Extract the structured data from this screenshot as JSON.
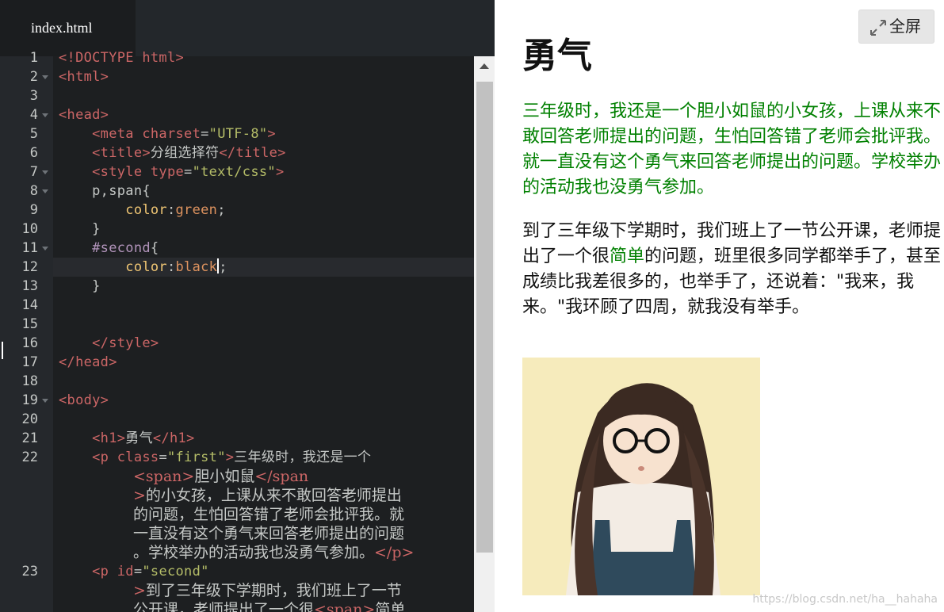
{
  "editor": {
    "tab_label": "index.html",
    "lines": [
      {
        "n": "1",
        "fold": false,
        "tokens": [
          [
            "tag",
            "<!DOCTYPE html>"
          ]
        ]
      },
      {
        "n": "2",
        "fold": true,
        "tokens": [
          [
            "tag",
            "<html>"
          ]
        ]
      },
      {
        "n": "3",
        "fold": false,
        "tokens": []
      },
      {
        "n": "4",
        "fold": true,
        "tokens": [
          [
            "tag",
            "<head>"
          ]
        ]
      },
      {
        "n": "5",
        "fold": false,
        "tokens": [
          [
            "plain",
            "    "
          ],
          [
            "tag",
            "<meta "
          ],
          [
            "attr",
            "charset"
          ],
          [
            "plain",
            "="
          ],
          [
            "str",
            "\"UTF-8\""
          ],
          [
            "tag",
            ">"
          ]
        ]
      },
      {
        "n": "6",
        "fold": false,
        "tokens": [
          [
            "plain",
            "    "
          ],
          [
            "tag",
            "<title>"
          ],
          [
            "plain",
            "分组选择符"
          ],
          [
            "tag",
            "</title>"
          ]
        ]
      },
      {
        "n": "7",
        "fold": true,
        "tokens": [
          [
            "plain",
            "    "
          ],
          [
            "tag",
            "<style "
          ],
          [
            "attr",
            "type"
          ],
          [
            "plain",
            "="
          ],
          [
            "str",
            "\"text/css\""
          ],
          [
            "tag",
            ">"
          ]
        ]
      },
      {
        "n": "8",
        "fold": true,
        "tokens": [
          [
            "plain",
            "    p,span{"
          ]
        ]
      },
      {
        "n": "9",
        "fold": false,
        "tokens": [
          [
            "plain",
            "        "
          ],
          [
            "prop",
            "color"
          ],
          [
            "plain",
            ":"
          ],
          [
            "val",
            "green"
          ],
          [
            "plain",
            ";"
          ]
        ]
      },
      {
        "n": "10",
        "fold": false,
        "tokens": [
          [
            "plain",
            "    }"
          ]
        ]
      },
      {
        "n": "11",
        "fold": true,
        "tokens": [
          [
            "plain",
            "    "
          ],
          [
            "sel",
            "#second"
          ],
          [
            "plain",
            "{"
          ]
        ]
      },
      {
        "n": "12",
        "fold": false,
        "cursor": true,
        "tokens": [
          [
            "plain",
            "        "
          ],
          [
            "prop",
            "color"
          ],
          [
            "plain",
            ":"
          ],
          [
            "val",
            "black"
          ]
        ],
        "after_cursor": ";"
      },
      {
        "n": "13",
        "fold": false,
        "tokens": [
          [
            "plain",
            "    }"
          ]
        ]
      },
      {
        "n": "14",
        "fold": false,
        "tokens": []
      },
      {
        "n": "15",
        "fold": false,
        "tokens": []
      },
      {
        "n": "16",
        "fold": false,
        "tokens": [
          [
            "plain",
            "    "
          ],
          [
            "tag",
            "</style>"
          ]
        ]
      },
      {
        "n": "17",
        "fold": false,
        "tokens": [
          [
            "tag",
            "</head>"
          ]
        ]
      },
      {
        "n": "18",
        "fold": false,
        "tokens": []
      },
      {
        "n": "19",
        "fold": true,
        "tokens": [
          [
            "tag",
            "<body>"
          ]
        ]
      },
      {
        "n": "20",
        "fold": false,
        "tokens": []
      },
      {
        "n": "21",
        "fold": false,
        "tokens": [
          [
            "plain",
            "    "
          ],
          [
            "tag",
            "<h1>"
          ],
          [
            "plain",
            "勇气"
          ],
          [
            "tag",
            "</h1>"
          ]
        ]
      },
      {
        "n": "22",
        "fold": false,
        "tokens": [
          [
            "plain",
            "    "
          ],
          [
            "tag",
            "<p "
          ],
          [
            "attr",
            "class"
          ],
          [
            "plain",
            "="
          ],
          [
            "str",
            "\"first\""
          ],
          [
            "tag",
            ">"
          ],
          [
            "plain",
            "三年级时，我还是一个"
          ]
        ]
      },
      {
        "n": "",
        "fold": false,
        "wrap": true,
        "tokens": [
          [
            "tag",
            "<span>"
          ],
          [
            "plain",
            "胆小如鼠"
          ],
          [
            "tag",
            "</span"
          ]
        ]
      },
      {
        "n": "",
        "fold": false,
        "wrap": true,
        "tokens": [
          [
            "tag",
            ">"
          ],
          [
            "plain",
            "的小女孩，上课从来不敢回答老师提出"
          ]
        ]
      },
      {
        "n": "",
        "fold": false,
        "wrap": true,
        "tokens": [
          [
            "plain",
            "的问题，生怕回答错了老师会批评我。就"
          ]
        ]
      },
      {
        "n": "",
        "fold": false,
        "wrap": true,
        "tokens": [
          [
            "plain",
            "一直没有这个勇气来回答老师提出的问题"
          ]
        ]
      },
      {
        "n": "",
        "fold": false,
        "wrap": true,
        "tokens": [
          [
            "plain",
            "。学校举办的活动我也没勇气参加。"
          ],
          [
            "tag",
            "</p>"
          ]
        ]
      },
      {
        "n": "23",
        "fold": false,
        "tokens": [
          [
            "plain",
            "    "
          ],
          [
            "tag",
            "<p "
          ],
          [
            "attr",
            "id"
          ],
          [
            "plain",
            "="
          ],
          [
            "str",
            "\"second\""
          ]
        ]
      },
      {
        "n": "",
        "fold": false,
        "wrap": true,
        "tokens": [
          [
            "tag",
            ">"
          ],
          [
            "plain",
            "到了三年级下学期时，我们班上了一节"
          ]
        ]
      },
      {
        "n": "",
        "fold": false,
        "wrap": true,
        "tokens": [
          [
            "plain",
            "公开课，老师提出了一个很"
          ],
          [
            "tag",
            "<span>"
          ],
          [
            "plain",
            "简单"
          ]
        ]
      }
    ],
    "colors": {
      "background": "#1d1f21",
      "tag": "#cc6666",
      "string": "#b5bd68",
      "property": "#f0c674",
      "value": "#de935f"
    }
  },
  "preview": {
    "fullscreen_label": "全屏",
    "fullscreen_icon": "expand-arrows-icon",
    "heading": "勇气",
    "first_paragraph": "三年级时，我还是一个胆小如鼠的小女孩，上课从来不敢回答老师提出的问题，生怕回答错了老师会批评我。就一直没有这个勇气来回答老师提出的问题。学校举办的活动我也没勇气参加。",
    "second_paragraph_before": "到了三年级下学期时，我们班上了一节公开课，老师提出了一个很",
    "second_paragraph_span": "简单",
    "second_paragraph_after": "的问题，班里很多同学都举手了，甚至成绩比我差很多的，也举手了，还说着：\"我来，我来。\"我环顾了四周，就我没有举手。",
    "image_alt": "illustration-girl-with-glasses",
    "watermark": "https://blog.csdn.net/ha__hahaha",
    "colors": {
      "green_text": "#008000",
      "black_text": "#111111"
    }
  }
}
